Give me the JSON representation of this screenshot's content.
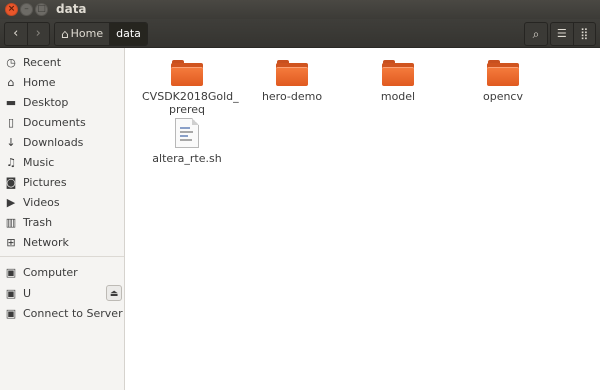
{
  "window": {
    "title": "data"
  },
  "header": {
    "breadcrumbs": [
      {
        "label": "Home"
      },
      {
        "label": "data"
      }
    ]
  },
  "sidebar": {
    "places": [
      {
        "label": "Recent",
        "icon": "clock-icon"
      },
      {
        "label": "Home",
        "icon": "home-icon"
      },
      {
        "label": "Desktop",
        "icon": "folder-icon"
      },
      {
        "label": "Documents",
        "icon": "document-icon"
      },
      {
        "label": "Downloads",
        "icon": "download-icon"
      },
      {
        "label": "Music",
        "icon": "music-icon"
      },
      {
        "label": "Pictures",
        "icon": "camera-icon"
      },
      {
        "label": "Videos",
        "icon": "video-icon"
      },
      {
        "label": "Trash",
        "icon": "trash-icon"
      },
      {
        "label": "Network",
        "icon": "network-icon"
      }
    ],
    "devices": [
      {
        "label": "Computer",
        "icon": "drive-icon"
      },
      {
        "label": "U",
        "icon": "drive-icon"
      },
      {
        "label": "Connect to Server",
        "icon": "server-icon"
      }
    ]
  },
  "files": [
    {
      "name": "CVSDK2018Gold_",
      "name2": "prereq",
      "type": "folder"
    },
    {
      "name": "hero-demo",
      "type": "folder"
    },
    {
      "name": "model",
      "type": "folder"
    },
    {
      "name": "opencv",
      "type": "folder"
    },
    {
      "name": "altera_rte.sh",
      "type": "script"
    }
  ],
  "colors": {
    "accent": "#e9562a",
    "folder": "#f07130"
  }
}
